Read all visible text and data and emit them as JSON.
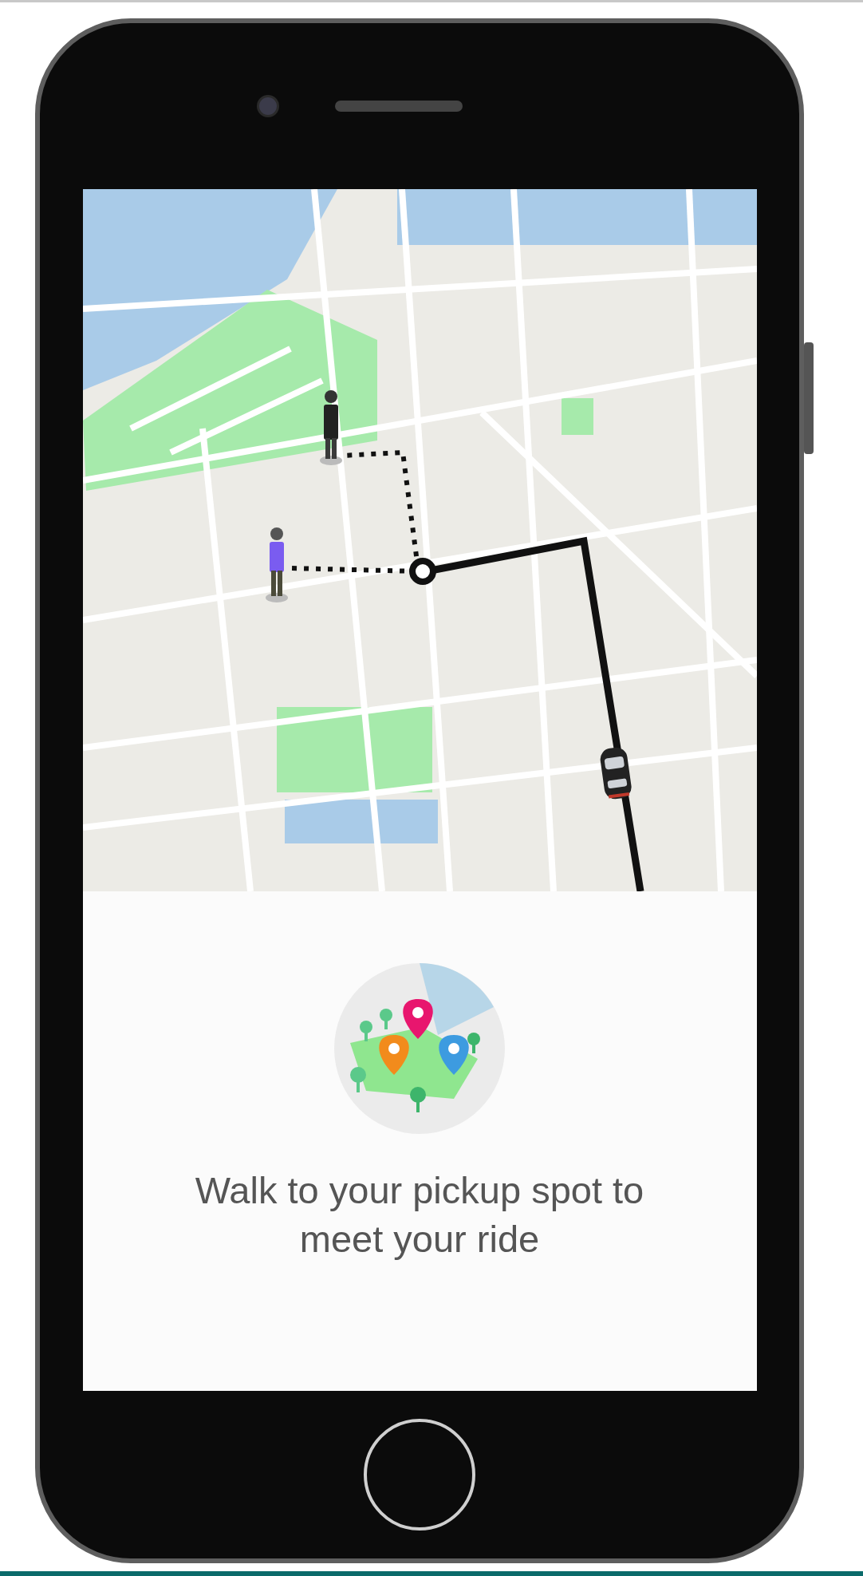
{
  "screen": {
    "message": "Walk to your pickup spot to meet your ride"
  }
}
